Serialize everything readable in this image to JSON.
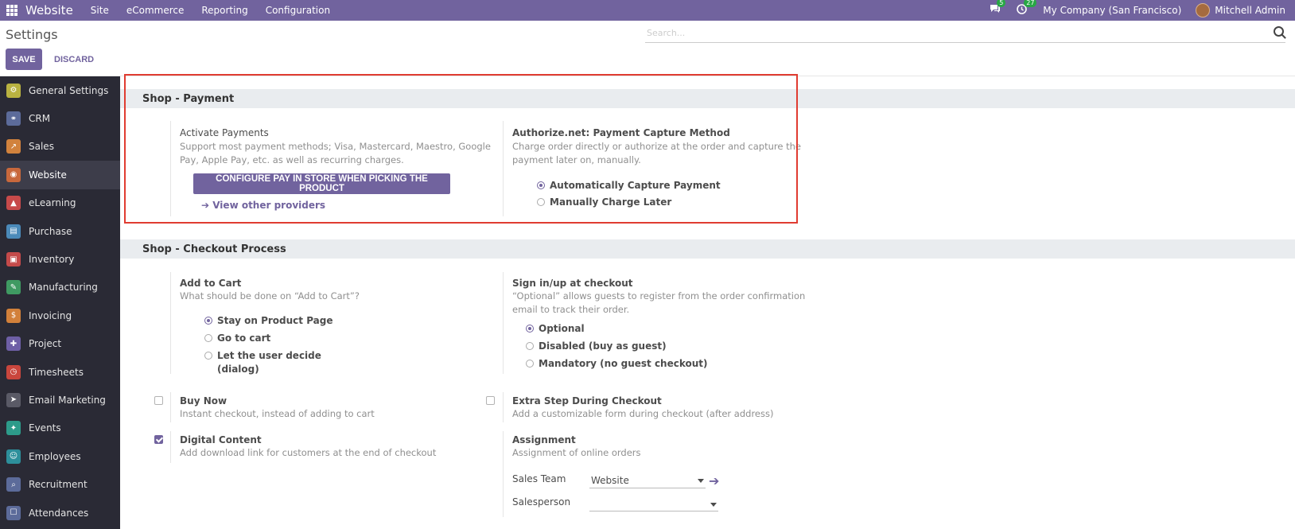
{
  "topbar": {
    "brand": "Website",
    "menus": [
      "Site",
      "eCommerce",
      "Reporting",
      "Configuration"
    ],
    "messages_count": "5",
    "activities_count": "27",
    "company": "My Company (San Francisco)",
    "user": "Mitchell Admin"
  },
  "control_panel": {
    "title": "Settings",
    "search_placeholder": "Search...",
    "save_label": "SAVE",
    "discard_label": "DISCARD"
  },
  "sidebar": {
    "items": [
      {
        "label": "General Settings",
        "icon": "gear-icon",
        "color": "#b9b241"
      },
      {
        "label": "CRM",
        "icon": "handshake-icon",
        "color": "#5c6b9a"
      },
      {
        "label": "Sales",
        "icon": "chart-icon",
        "color": "#d1823d"
      },
      {
        "label": "Website",
        "icon": "globe-icon",
        "color": "#c8683c"
      },
      {
        "label": "eLearning",
        "icon": "graduation-icon",
        "color": "#c74a4a"
      },
      {
        "label": "Purchase",
        "icon": "purchase-icon",
        "color": "#4b8ab9"
      },
      {
        "label": "Inventory",
        "icon": "box-icon",
        "color": "#c44a4a"
      },
      {
        "label": "Manufacturing",
        "icon": "wrench-icon",
        "color": "#3f9a62"
      },
      {
        "label": "Invoicing",
        "icon": "invoice-icon",
        "color": "#d2803a"
      },
      {
        "label": "Project",
        "icon": "puzzle-icon",
        "color": "#6e5fa6"
      },
      {
        "label": "Timesheets",
        "icon": "stopwatch-icon",
        "color": "#c9463d"
      },
      {
        "label": "Email Marketing",
        "icon": "paper-plane-icon",
        "color": "#5a5a66"
      },
      {
        "label": "Events",
        "icon": "ticket-icon",
        "color": "#2d9b8a"
      },
      {
        "label": "Employees",
        "icon": "people-icon",
        "color": "#2d8f9b"
      },
      {
        "label": "Recruitment",
        "icon": "search-person-icon",
        "color": "#5c6b9a"
      },
      {
        "label": "Attendances",
        "icon": "attendance-icon",
        "color": "#5c6b9a"
      }
    ],
    "active_index": 3
  },
  "payment": {
    "heading": "Shop - Payment",
    "activate_title": "Activate Payments",
    "activate_desc_1": "Support most payment methods; Visa, Mastercard, Maestro, Google",
    "activate_desc_2": "Pay, Apple Pay, etc. as well as recurring charges.",
    "configure_button": "CONFIGURE PAY IN STORE WHEN PICKING THE PRODUCT",
    "view_providers": "View other providers",
    "authorize_title": "Authorize.net: Payment Capture Method",
    "authorize_desc_1": "Charge order directly or authorize at the order and capture the",
    "authorize_desc_2": "payment later on, manually.",
    "capture_options": [
      "Automatically Capture Payment",
      "Manually Charge Later"
    ],
    "capture_selected": "Automatically Capture Payment"
  },
  "checkout": {
    "heading": "Shop - Checkout Process",
    "add_to_cart_title": "Add to Cart",
    "add_to_cart_desc": "What should be done on “Add to Cart”?",
    "cart_options": [
      "Stay on Product Page",
      "Go to cart",
      "Let the user decide",
      "(dialog)"
    ],
    "cart_selected": "Stay on Product Page",
    "signin_title": "Sign in/up at checkout",
    "signin_desc_1": "“Optional” allows guests to register from the order confirmation",
    "signin_desc_2": "email to track their order.",
    "signin_options": [
      "Optional",
      "Disabled (buy as guest)",
      "Mandatory (no guest checkout)"
    ],
    "signin_selected": "Optional",
    "buy_now_title": "Buy Now",
    "buy_now_desc": "Instant checkout, instead of adding to cart",
    "buy_now_checked": false,
    "extra_step_title": "Extra Step During Checkout",
    "extra_step_desc": "Add a customizable form during checkout (after address)",
    "extra_step_checked": false,
    "digital_title": "Digital Content",
    "digital_desc": "Add download link for customers at the end of checkout",
    "digital_checked": true,
    "assignment_title": "Assignment",
    "assignment_desc": "Assignment of online orders",
    "sales_team_label": "Sales Team",
    "sales_team_value": "Website",
    "salesperson_label": "Salesperson",
    "salesperson_value": ""
  }
}
